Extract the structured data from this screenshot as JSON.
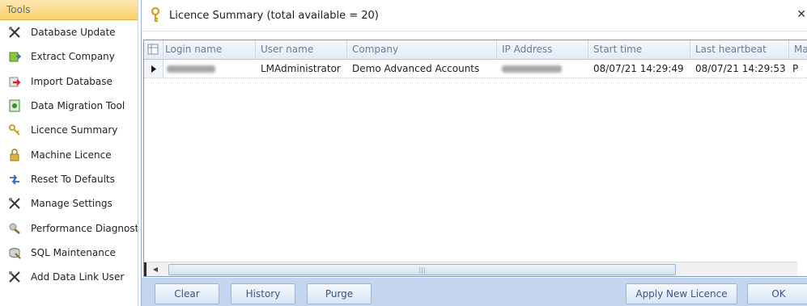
{
  "tools": {
    "header": "Tools",
    "items": [
      {
        "label": "Database Update",
        "icon": "tools-cross-icon"
      },
      {
        "label": "Extract Company",
        "icon": "extract-company-icon"
      },
      {
        "label": "Import Database",
        "icon": "import-database-icon"
      },
      {
        "label": "Data Migration Tool",
        "icon": "data-migration-icon"
      },
      {
        "label": "Licence Summary",
        "icon": "key-icon"
      },
      {
        "label": "Machine Licence",
        "icon": "lock-icon"
      },
      {
        "label": "Reset To Defaults",
        "icon": "reset-arrows-icon"
      },
      {
        "label": "Manage Settings",
        "icon": "tools-cross-icon"
      },
      {
        "label": "Performance Diagnostics",
        "icon": "performance-icon"
      },
      {
        "label": "SQL Maintenance",
        "icon": "sql-maintenance-icon"
      },
      {
        "label": "Add Data Link User",
        "icon": "tools-cross-icon"
      }
    ]
  },
  "dialog": {
    "title": "Licence Summary (total available = 20)",
    "title_icon": "key-icon",
    "close_glyph": "✕",
    "columns": [
      "Login name",
      "User name",
      "Company",
      "IP Address",
      "Start time",
      "Last heartbeat",
      "Ma"
    ],
    "rows": [
      {
        "login_name": "",
        "user_name": "LMAdministrator",
        "company": "Demo Advanced Accounts",
        "ip_address": "",
        "start_time": "08/07/21 14:29:49",
        "last_heartbeat": "08/07/21 14:29:53",
        "ma": "P"
      }
    ],
    "buttons": {
      "clear": "Clear",
      "history": "History",
      "purge": "Purge",
      "apply_new_licence": "Apply New Licence",
      "ok": "OK"
    }
  },
  "colors": {
    "tools_header_bg": "#f9cf6b",
    "button_bar_bg": "#c4d6ee",
    "button_text": "#3a5683"
  }
}
